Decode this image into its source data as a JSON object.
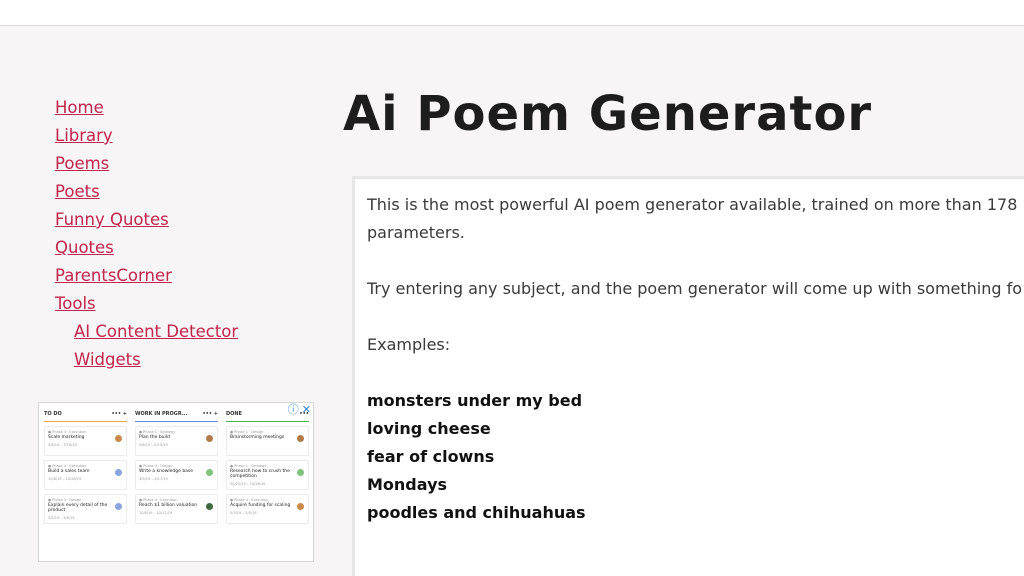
{
  "nav": {
    "items": [
      {
        "label": "Home"
      },
      {
        "label": "Library"
      },
      {
        "label": "Poems"
      },
      {
        "label": "Poets"
      },
      {
        "label": "Funny Quotes"
      },
      {
        "label": "Quotes"
      },
      {
        "label": "ParentsCorner"
      },
      {
        "label": "Tools"
      },
      {
        "label": "AI Content Detector"
      },
      {
        "label": "Widgets"
      }
    ]
  },
  "main": {
    "title": "Ai Poem Generator",
    "intro_line1": "This is the most powerful AI poem generator available, trained on more than 178",
    "intro_line2": "parameters.",
    "instruction": "Try entering any subject, and the poem generator will come up with something fo",
    "examples_label": "Examples:",
    "examples": [
      "monsters under my bed",
      "loving cheese",
      "fear of clowns",
      "Mondays",
      "poodles and chihuahuas"
    ]
  },
  "ad": {
    "info_icon": "ⓘ",
    "close_icon": "✕",
    "columns": [
      {
        "name": "TO DO",
        "cards": [
          {
            "tag": "● Phase 4 · Execution",
            "title": "Scale marketing",
            "meta": "5/6/19 – 7/16/19"
          },
          {
            "tag": "● Phase 4 · Execution",
            "title": "Build a sales team",
            "meta": "10/8/19 – 10/28/19"
          },
          {
            "tag": "● Phase 3 · Design",
            "title": "Explain every detail of the product",
            "meta": "3/5/19 – 4/8/19"
          }
        ]
      },
      {
        "name": "WORK IN PROGR...",
        "cards": [
          {
            "tag": "● Phase 1 · Strategy",
            "title": "Plan the build",
            "meta": "5/6/19 – 5/15/19"
          },
          {
            "tag": "● Phase 3 · Design",
            "title": "Write a knowledge base",
            "meta": "4/9/19 – 4/17/19"
          },
          {
            "tag": "● Phase 4 · Execution",
            "title": "Reach $1 billion valuation",
            "meta": "10/8/19 – 10/11/19"
          }
        ]
      },
      {
        "name": "DONE",
        "cards": [
          {
            "tag": "● Phase 1 · Design",
            "title": "Brainstorming meetings",
            "meta": ""
          },
          {
            "tag": "● Phase 1 · Strategy",
            "title": "Research how to crush the competition",
            "meta": "10/25/19 – 10/28/19"
          },
          {
            "tag": "● Phase 4 · Execution",
            "title": "Acquire funding for scaling",
            "meta": "5/3/19 – 5/5/19"
          }
        ]
      }
    ]
  },
  "colors": {
    "link": "#c2244c",
    "title": "#1d1d1d",
    "bg": "#f7f5f6"
  }
}
